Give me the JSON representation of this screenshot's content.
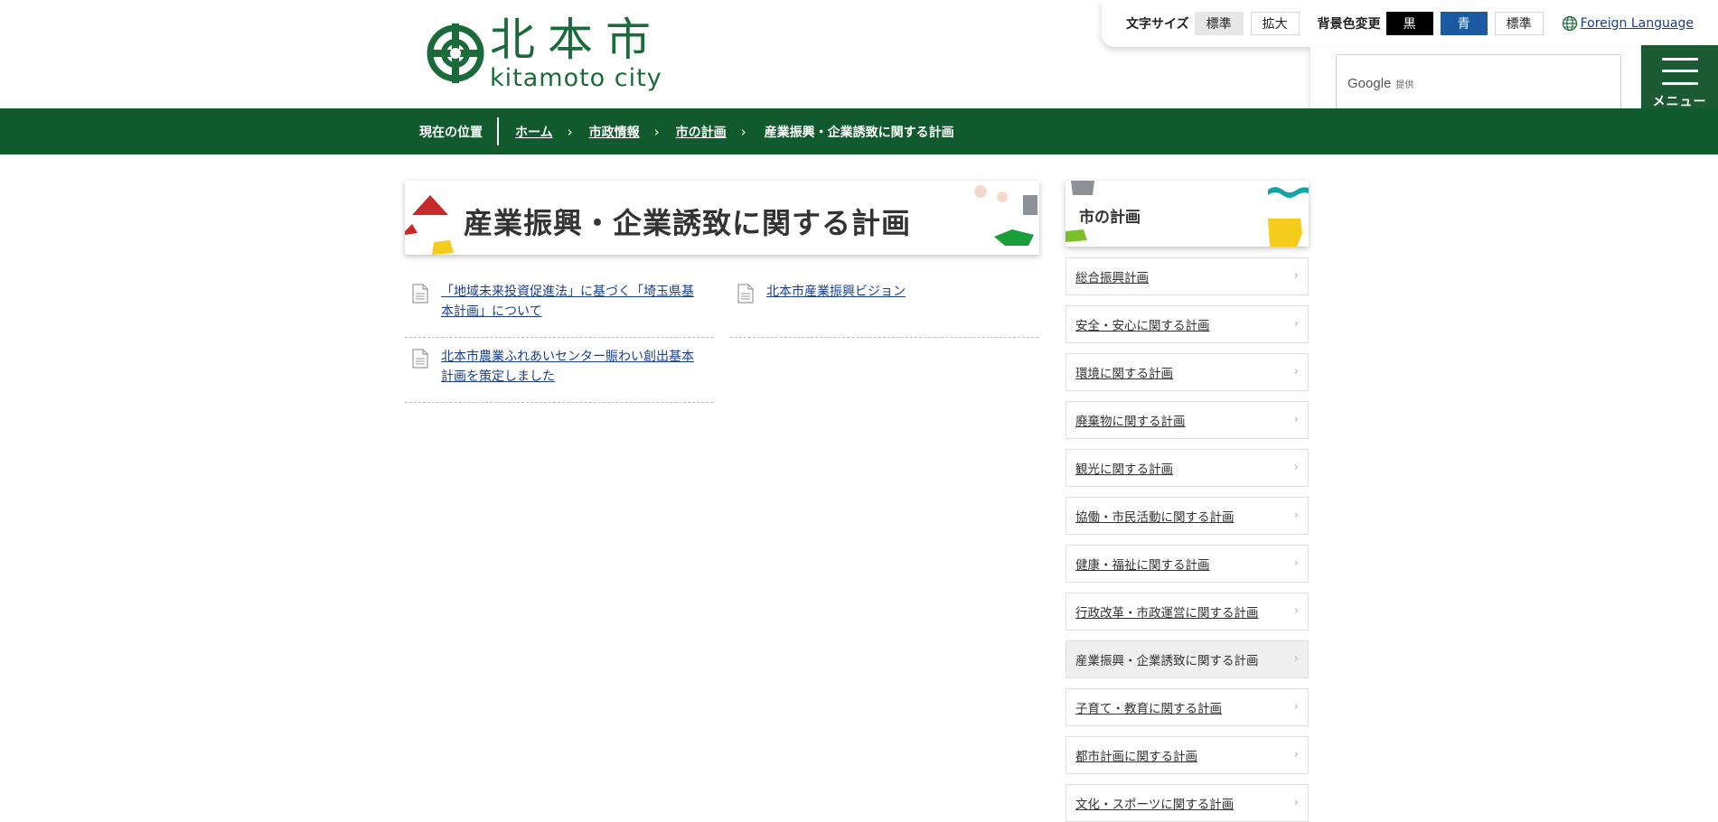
{
  "logo": {
    "kanji": "北本市",
    "roman": "kitamoto city"
  },
  "utility": {
    "font_size_label": "文字サイズ",
    "font_size_standard": "標準",
    "font_size_large": "拡大",
    "bg_label": "背景色変更",
    "bg_black": "黒",
    "bg_blue": "青",
    "bg_standard": "標準",
    "foreign_language": "Foreign Language"
  },
  "search": {
    "brand": "Google",
    "brand_sub": "提供"
  },
  "menu": {
    "label": "メニュー"
  },
  "breadcrumb": {
    "current_label": "現在の位置",
    "items": [
      "ホーム",
      "市政情報",
      "市の計画"
    ],
    "current": "産業振興・企業誘致に関する計画"
  },
  "page": {
    "title": "産業振興・企業誘致に関する計画"
  },
  "documents": [
    {
      "line1": "「地域未来投資促進法」に基づく「埼玉県基",
      "line2": "本計画」について"
    },
    {
      "line1": "北本市産業振興ビジョン",
      "line2": ""
    },
    {
      "line1": "北本市農業ふれあいセンター賑わい創出基本",
      "line2": "計画を策定しました"
    }
  ],
  "sidebar": {
    "title": "市の計画",
    "items": [
      "総合振興計画",
      "安全・安心に関する計画",
      "環境に関する計画",
      "廃棄物に関する計画",
      "観光に関する計画",
      "協働・市民活動に関する計画",
      "健康・福祉に関する計画",
      "行政改革・市政運営に関する計画",
      "産業振興・企業誘致に関する計画",
      "子育て・教育に関する計画",
      "都市計画に関する計画",
      "文化・スポーツに関する計画"
    ],
    "current_index": 8
  },
  "colors": {
    "brand_green": "#115a2d",
    "link_blue": "#1b3f8c",
    "accent_blue": "#1b5aa0"
  }
}
